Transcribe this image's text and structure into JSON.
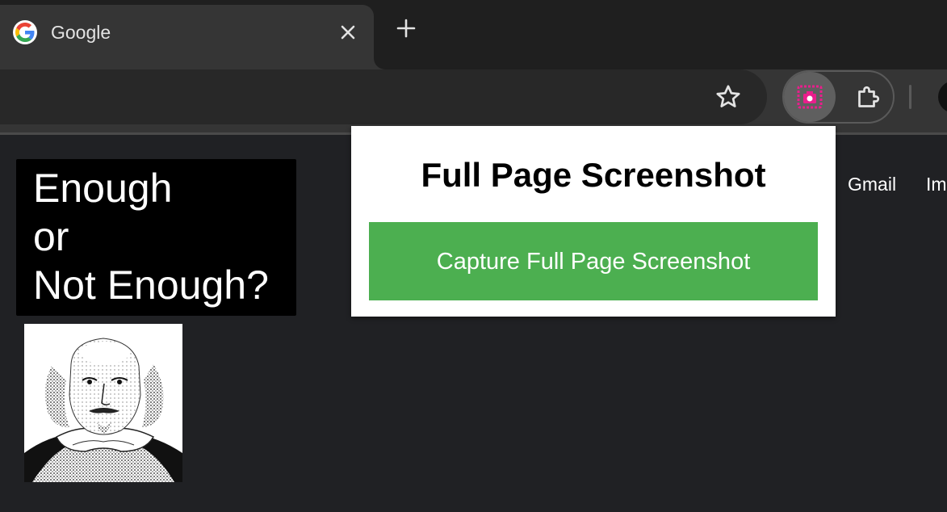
{
  "browser": {
    "tab": {
      "title": "Google",
      "favicon_icon": "google-g-icon",
      "close_icon": "close-icon"
    },
    "new_tab_icon": "plus-icon",
    "toolbar": {
      "bookmark_icon": "star-icon",
      "extensions": [
        {
          "name": "full-page-screenshot",
          "icon": "screenshot-camera-icon",
          "active": true,
          "accent": "#e91e8c"
        },
        {
          "name": "extensions-menu",
          "icon": "puzzle-icon",
          "active": false
        }
      ]
    }
  },
  "page": {
    "doodle": {
      "lines": [
        "Enough",
        "or",
        "Not Enough?"
      ]
    },
    "portrait_icon": "portrait-image",
    "links": {
      "gmail": "Gmail",
      "images": "Im"
    }
  },
  "popup": {
    "title": "Full Page Screenshot",
    "capture_button": "Capture Full Page Screenshot",
    "button_color": "#4caf50"
  },
  "colors": {
    "tabstrip_bg": "#1f1f1f",
    "active_tab_bg": "#353535",
    "page_bg": "#202124"
  }
}
